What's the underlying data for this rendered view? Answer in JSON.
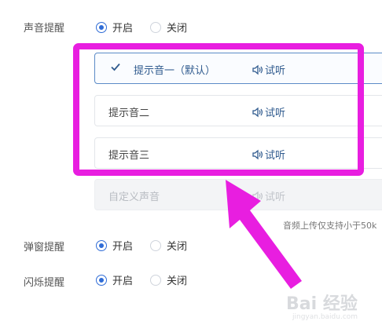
{
  "sound_setting": {
    "label": "声音提醒",
    "on_label": "开启",
    "off_label": "关闭",
    "selected": "on"
  },
  "sounds": [
    {
      "name": "提示音一（默认）",
      "listen": "试听",
      "selected": true
    },
    {
      "name": "提示音二",
      "listen": "试听",
      "selected": false
    },
    {
      "name": "提示音三",
      "listen": "试听",
      "selected": false
    },
    {
      "name": "自定义声音",
      "listen": "试听",
      "disabled": true
    }
  ],
  "upload_hint": "音频上传仅支持小于50k",
  "popup_setting": {
    "label": "弹窗提醒",
    "on_label": "开启",
    "off_label": "关闭",
    "selected": "on"
  },
  "flash_setting": {
    "label": "闪烁提醒",
    "on_label": "开启",
    "off_label": "关闭",
    "selected": "on"
  },
  "annotation": {
    "highlight_color": "#e81ee0"
  },
  "watermark": {
    "text": "Bai 经验",
    "sub": "jingyan.baidu.com"
  }
}
